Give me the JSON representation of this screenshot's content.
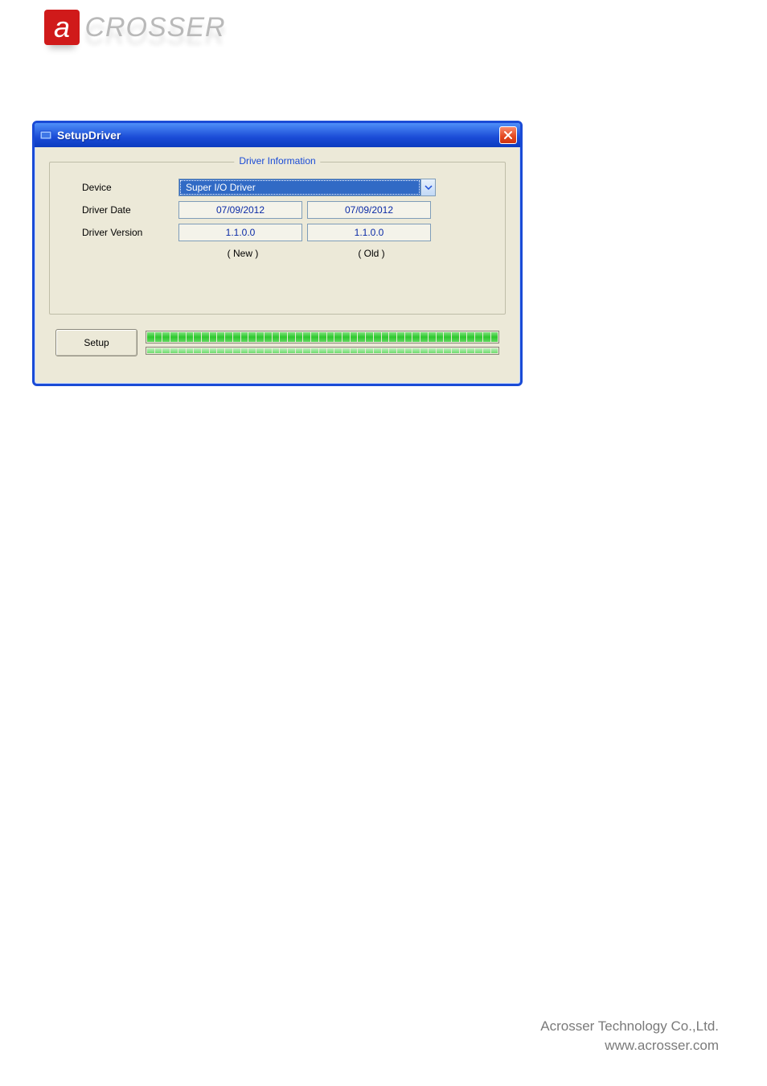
{
  "brand": {
    "logo_letter": "a",
    "logo_rest": "CROSSER"
  },
  "window": {
    "title": "SetupDriver",
    "groupbox_legend": "Driver Information",
    "labels": {
      "device": "Device",
      "driver_date": "Driver Date",
      "driver_version": "Driver Version"
    },
    "device_selected": "Super I/O Driver",
    "cols": {
      "new": {
        "footer": "( New )",
        "date": "07/09/2012",
        "version": "1.1.0.0"
      },
      "old": {
        "footer": "( Old )",
        "date": "07/09/2012",
        "version": "1.1.0.0"
      }
    },
    "setup_button": "Setup"
  },
  "footer": {
    "company": "Acrosser Technology Co.,Ltd.",
    "url": "www.acrosser.com"
  }
}
